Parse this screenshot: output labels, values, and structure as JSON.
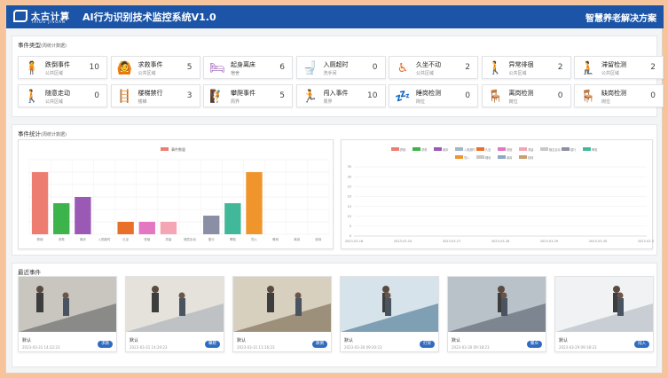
{
  "header": {
    "logo_text": "太古计算",
    "logo_sub": "TAIGU JISUAN",
    "title": "AI行为识别技术监控系统V1.0",
    "right_title": "智慧养老解决方案"
  },
  "types": {
    "title": "事件类型",
    "note": "(周统计数据)",
    "cards": [
      {
        "name": "跌倒事件",
        "sub": "公共区域",
        "count": "10",
        "icon": "person-fallen-icon",
        "glyph": "🧍",
        "color": "#e06666"
      },
      {
        "name": "求救事件",
        "sub": "公共区域",
        "count": "5",
        "icon": "person-arms-raised-icon",
        "glyph": "🙆",
        "color": "#3cb44b"
      },
      {
        "name": "起身离床",
        "sub": "宿舍",
        "count": "6",
        "icon": "bed-icon",
        "glyph": "🛏",
        "color": "#9b59b6"
      },
      {
        "name": "入厕超时",
        "sub": "洗手间",
        "count": "0",
        "icon": "toilet-icon",
        "glyph": "🚽",
        "color": "#7f9fb0"
      },
      {
        "name": "久坐不动",
        "sub": "公共区域",
        "count": "2",
        "icon": "wheelchair-icon",
        "glyph": "♿",
        "color": "#e8702a"
      },
      {
        "name": "异常徘徊",
        "sub": "公共区域",
        "count": "2",
        "icon": "person-standing-icon",
        "glyph": "🚶",
        "color": "#e377c2"
      },
      {
        "name": "滞留检测",
        "sub": "公共区域",
        "count": "2",
        "icon": "person-waiting-icon",
        "glyph": "🧎",
        "color": "#e7a0a8"
      },
      {
        "name": "随意走动",
        "sub": "公共区域",
        "count": "0",
        "icon": "person-walking-icon",
        "glyph": "🚶",
        "color": "#e06666"
      },
      {
        "name": "楼梯禁行",
        "sub": "楼梯",
        "count": "3",
        "icon": "stairs-icon",
        "glyph": "🪜",
        "color": "#7f8fa6"
      },
      {
        "name": "攀爬事件",
        "sub": "周界",
        "count": "5",
        "icon": "person-climbing-icon",
        "glyph": "🧗",
        "color": "#2ecc71"
      },
      {
        "name": "闯入事件",
        "sub": "周界",
        "count": "10",
        "icon": "person-intrusion-icon",
        "glyph": "🏃",
        "color": "#e8922a"
      },
      {
        "name": "睡岗检测",
        "sub": "岗位",
        "count": "0",
        "icon": "sleeping-desk-icon",
        "glyph": "💤",
        "color": "#444444"
      },
      {
        "name": "离岗检测",
        "sub": "岗位",
        "count": "0",
        "icon": "empty-desk-icon",
        "glyph": "🪑",
        "color": "#5a8fbf"
      },
      {
        "name": "缺岗检测",
        "sub": "岗位",
        "count": "0",
        "icon": "vacant-chair-icon",
        "glyph": "🪑",
        "color": "#b5895a"
      }
    ]
  },
  "stats": {
    "title": "事件统计",
    "note": "(周统计数据)"
  },
  "chart_data": [
    {
      "type": "bar",
      "legend": [
        "事件数量"
      ],
      "legend_position": "top",
      "categories": [
        "跌倒",
        "求救",
        "离床",
        "入厕超时",
        "久坐",
        "徘徊",
        "滞留",
        "随意走动",
        "楼行",
        "攀爬",
        "闯入",
        "睡岗",
        "离岗",
        "缺岗"
      ],
      "values": [
        10,
        5,
        6,
        0,
        2,
        2,
        2,
        0,
        3,
        5,
        10,
        0,
        0,
        0
      ],
      "colors": [
        "#ee7d71",
        "#3cb44b",
        "#9b59b6",
        "#9fb8c8",
        "#e8702a",
        "#e377c2",
        "#f4a6b4",
        "#c8c8c8",
        "#8b8fa6",
        "#42b89a",
        "#f0952c",
        "#c9c9c9",
        "#c9c9c9",
        "#c9c9c9"
      ],
      "ylim": [
        0,
        12
      ],
      "grid": true
    },
    {
      "type": "line",
      "legend": [
        "跌倒",
        "求救",
        "离床",
        "入厕超时",
        "久坐",
        "徘徊",
        "滞留",
        "随意走动",
        "楼行",
        "攀爬",
        "闯入",
        "睡岗",
        "离岗",
        "缺岗"
      ],
      "legend_colors": [
        "#ee7d71",
        "#3cb44b",
        "#9b59b6",
        "#9fb8c8",
        "#e8702a",
        "#e377c2",
        "#f4a6b4",
        "#c8c8c8",
        "#8b8fa6",
        "#42b89a",
        "#f0952c",
        "#c9c9c9",
        "#8fa8c8",
        "#c8a070"
      ],
      "legend_position": "top",
      "x": [
        "2023-03-16",
        "2023-03-24",
        "2023-03-27",
        "2023-03-28",
        "2023-03-29",
        "2023-03-30",
        "2023-03-31"
      ],
      "yticks": [
        0,
        5,
        10,
        15,
        20,
        25,
        30,
        35
      ],
      "ylim": [
        0,
        35
      ],
      "series": [],
      "grid": true
    }
  ],
  "recent": {
    "title": "最近事件",
    "events": [
      {
        "caption": "默认",
        "time": "2023-03-31 14:22:23",
        "tag": "求救"
      },
      {
        "caption": "默认",
        "time": "2023-03-31 14:20:23",
        "tag": "攀爬"
      },
      {
        "caption": "默认",
        "time": "2023-03-31 11:16:23",
        "tag": "跌倒"
      },
      {
        "caption": "默认",
        "time": "2023-03-30 09:20:23",
        "tag": "打架"
      },
      {
        "caption": "默认",
        "time": "2023-03-30 09:18:23",
        "tag": "聚众"
      },
      {
        "caption": "默认",
        "time": "2023-03-29 09:18:23",
        "tag": "闯入"
      }
    ]
  }
}
